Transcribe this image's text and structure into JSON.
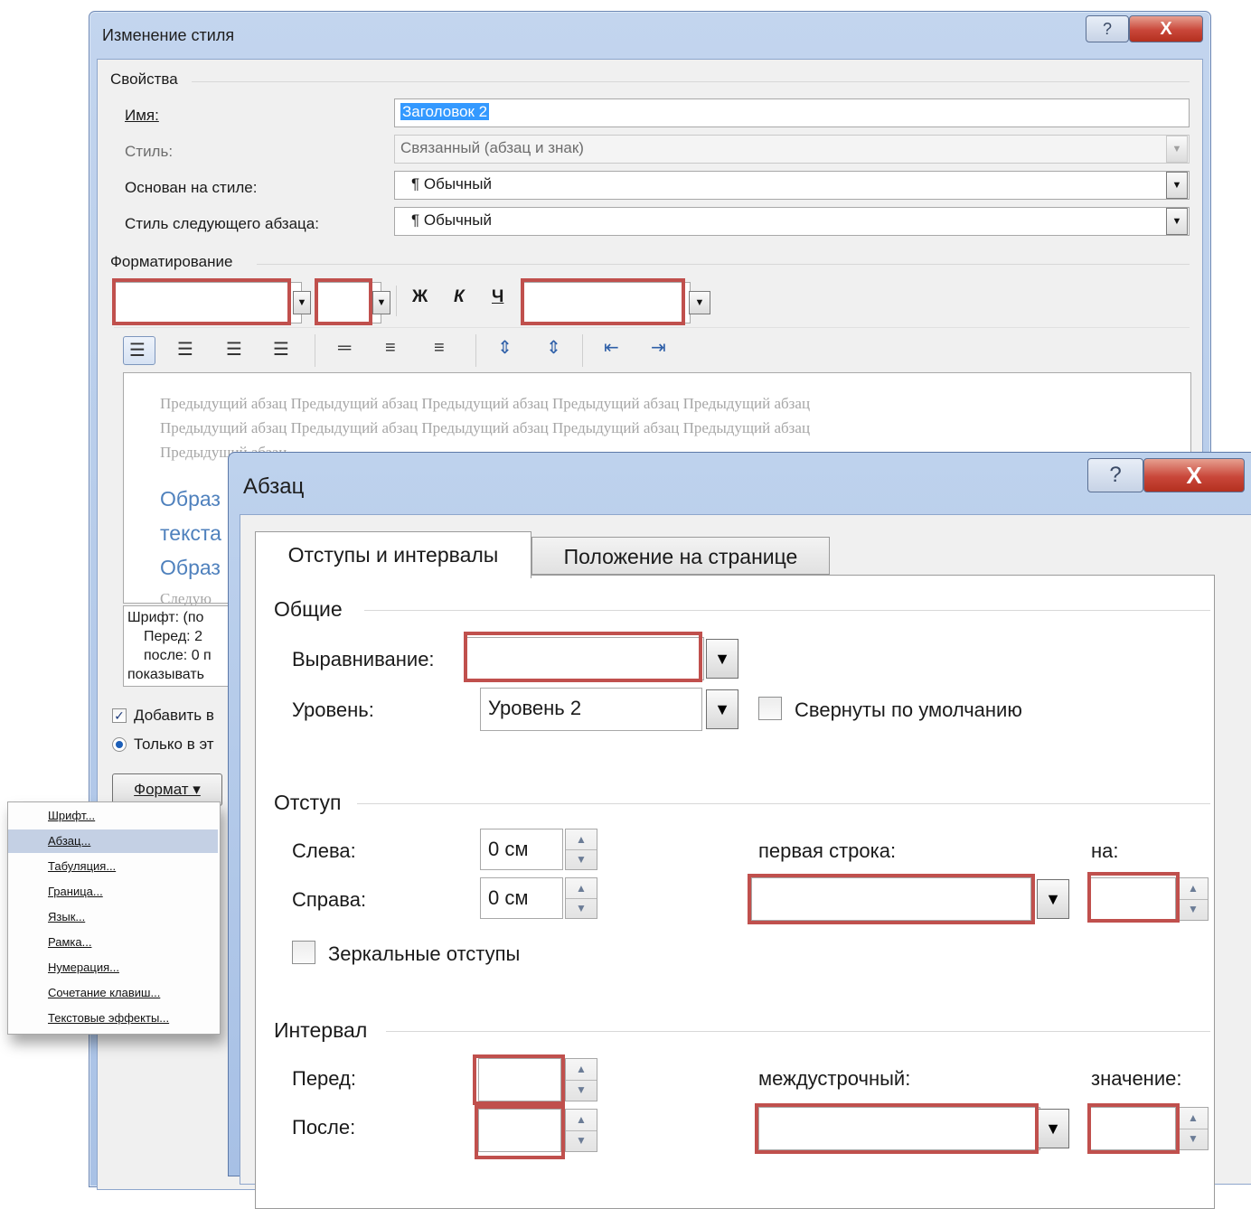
{
  "modify_style_dialog": {
    "title": "Изменение стиля",
    "help_glyph": "?",
    "close_glyph": "X",
    "properties": {
      "group_label": "Свойства",
      "name_label": "Имя:",
      "name_value": "Заголовок 2",
      "style_label": "Стиль:",
      "style_value": "Связанный (абзац и знак)",
      "based_on_label": "Основан на стиле:",
      "based_on_value": "¶ Обычный",
      "next_style_label": "Стиль следующего абзаца:",
      "next_style_value": "¶ Обычный"
    },
    "formatting": {
      "group_label": "Форматирование",
      "bold": "Ж",
      "italic": "К",
      "underline": "Ч"
    },
    "preview": {
      "prev_line_1": "Предыдущий абзац Предыдущий абзац Предыдущий абзац Предыдущий абзац Предыдущий абзац",
      "prev_line_2": "Предыдущий абзац Предыдущий абзац Предыдущий абзац Предыдущий абзац Предыдущий абзац",
      "prev_line_3": "Предыдущий абзац",
      "sample_1": "Образ",
      "sample_2": "текста",
      "sample_3": "Образ",
      "next_fragment": "Следую"
    },
    "description": {
      "line_1": "Шрифт: (по",
      "line_2": "Перед:  2",
      "line_3": "после: 0 п",
      "line_4": "показывать"
    },
    "add_to_gallery_label": "Добавить в",
    "only_in_doc_label": "Только в эт",
    "format_button": "Формат ▾"
  },
  "format_menu": {
    "items": [
      {
        "label": "Шрифт..."
      },
      {
        "label": "Абзац...",
        "selected": true
      },
      {
        "label": "Табуляция..."
      },
      {
        "label": "Граница..."
      },
      {
        "label": "Язык..."
      },
      {
        "label": "Рамка..."
      },
      {
        "label": "Нумерация..."
      },
      {
        "label": "Сочетание клавиш..."
      },
      {
        "label": "Текстовые эффекты..."
      }
    ]
  },
  "paragraph_dialog": {
    "title": "Абзац",
    "help_glyph": "?",
    "close_glyph": "X",
    "tabs": [
      {
        "label": "Отступы и интервалы",
        "active": true
      },
      {
        "label": "Положение на странице",
        "active": false
      }
    ],
    "general": {
      "group_label": "Общие",
      "alignment_label": "Выравнивание:",
      "alignment_value": "",
      "level_label": "Уровень:",
      "level_value": "Уровень 2",
      "collapsed_label": "Свернуты по умолчанию"
    },
    "indent": {
      "group_label": "Отступ",
      "left_label": "Слева:",
      "left_value": "0 см",
      "right_label": "Справа:",
      "right_value": "0 см",
      "first_line_label": "первая строка:",
      "by_label": "на:",
      "mirror_label": "Зеркальные отступы"
    },
    "spacing": {
      "group_label": "Интервал",
      "before_label": "Перед:",
      "after_label": "После:",
      "line_spacing_label": "междустрочный:",
      "value_label": "значение:"
    }
  },
  "colors": {
    "highlight_box": "#c0504d",
    "preview_heading": "#4f81bd",
    "menu_selected": "#c4d0e4"
  }
}
